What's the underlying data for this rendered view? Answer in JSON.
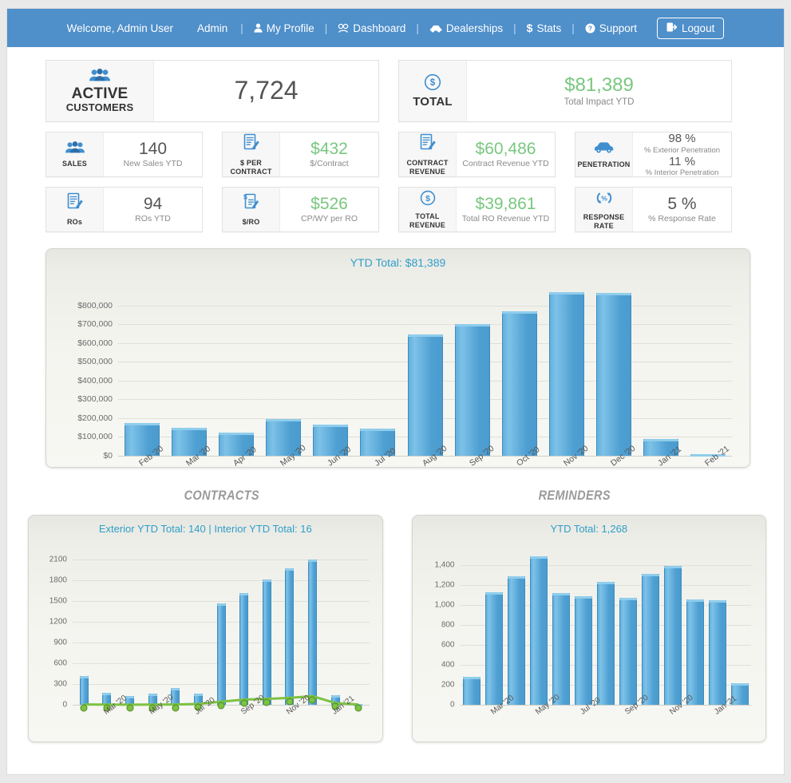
{
  "navbar": {
    "welcome": "Welcome, Admin User",
    "admin": "Admin",
    "separator": "|",
    "items": [
      {
        "label": "My Profile",
        "icon": "user-icon"
      },
      {
        "label": "Dashboard",
        "icon": "dashboard-icon"
      },
      {
        "label": "Dealerships",
        "icon": "car-icon"
      },
      {
        "label": "Stats",
        "icon": "dollar-icon"
      },
      {
        "label": "Support",
        "icon": "question-circle-icon"
      }
    ],
    "logout": "Logout"
  },
  "kpis": {
    "active_customers": {
      "label_line1": "ACTIVE",
      "label_line2": "CUSTOMERS",
      "value": "7,724",
      "icon": "users-icon"
    },
    "total": {
      "label": "TOTAL",
      "value": "$81,389",
      "sub": "Total Impact YTD",
      "icon": "dollar-circle-icon"
    },
    "sales": {
      "label": "SALES",
      "value": "140",
      "sub": "New Sales YTD",
      "icon": "users-icon"
    },
    "per_contract": {
      "label_line1": "$ PER",
      "label_line2": "CONTRACT",
      "value": "$432",
      "sub": "$/Contract",
      "icon": "contract-icon"
    },
    "contract_revenue": {
      "label_line1": "CONTRACT",
      "label_line2": "REVENUE",
      "value": "$60,486",
      "sub": "Contract Revenue YTD",
      "icon": "contract-icon"
    },
    "penetration": {
      "label": "PENETRATION",
      "value1": "98 %",
      "sub1": "% Exterior Penetration",
      "value2": "11 %",
      "sub2": "% Interior Penetration",
      "icon": "car-icon"
    },
    "ros": {
      "label": "ROs",
      "value": "94",
      "sub": "ROs YTD",
      "icon": "contract-icon"
    },
    "per_ro": {
      "label": "$/RO",
      "value": "$526",
      "sub": "CP/WY per RO",
      "icon": "dollar-contract-icon"
    },
    "total_revenue": {
      "label_line1": "TOTAL",
      "label_line2": "REVENUE",
      "value": "$39,861",
      "sub": "Total RO Revenue YTD",
      "icon": "dollar-circle-icon"
    },
    "response_rate": {
      "label_line1": "RESPONSE",
      "label_line2": "RATE",
      "value": "5 %",
      "sub": "% Response Rate",
      "icon": "percent-refresh-icon"
    }
  },
  "sections": {
    "contracts_heading": "CONTRACTS",
    "reminders_heading": "REMINDERS"
  },
  "colors": {
    "navbar": "#4f8fca",
    "bar_blue": "#5ba9d8",
    "line_green": "#7dc242",
    "title_teal": "#2f9fc7",
    "value_green": "#79c77f",
    "icon_blue": "#3f8fd0"
  },
  "chart_data": [
    {
      "id": "impact",
      "type": "bar",
      "title": "YTD Total: $81,389",
      "xlabel": "",
      "ylabel": "",
      "ylim": [
        0,
        900000
      ],
      "ytick_values": [
        0,
        100000,
        200000,
        300000,
        400000,
        500000,
        600000,
        700000,
        800000
      ],
      "ytick_labels": [
        "$0",
        "$100,000",
        "$200,000",
        "$300,000",
        "$400,000",
        "$500,000",
        "$600,000",
        "$700,000",
        "$800,000"
      ],
      "grid": true,
      "legend": "none",
      "categories": [
        "Feb '20",
        "Mar '20",
        "Apr '20",
        "May '20",
        "Jun '20",
        "Jul '20",
        "Aug '20",
        "Sep '20",
        "Oct '20",
        "Nov '20",
        "Dec '20",
        "Jan '21",
        "Feb '21"
      ],
      "values": [
        175000,
        148000,
        123000,
        196000,
        167000,
        143000,
        645000,
        700000,
        768000,
        870000,
        868000,
        90000,
        8000
      ]
    },
    {
      "id": "contracts",
      "type": "bar",
      "title": "Exterior YTD Total: 140 | Interior YTD Total: 16",
      "xlabel": "",
      "ylabel": "",
      "ylim": [
        0,
        2250
      ],
      "ytick_values": [
        0,
        300,
        600,
        900,
        1200,
        1500,
        1800,
        2100
      ],
      "ytick_labels": [
        "0",
        "300",
        "600",
        "900",
        "1200",
        "1500",
        "1800",
        "2100"
      ],
      "grid": true,
      "legend": "none",
      "categories": [
        "Feb '20",
        "Mar '20",
        "Apr '20",
        "May '20",
        "Jun '20",
        "Jul '20",
        "Aug '20",
        "Sep '20",
        "Oct '20",
        "Nov '20",
        "Dec '20",
        "Jan '21",
        "Feb '21"
      ],
      "xtick_labels": [
        "",
        "Mar '20",
        "",
        "May '20",
        "",
        "Jul '20",
        "",
        "Sep '20",
        "",
        "Nov '20",
        "",
        "Jan '21",
        ""
      ],
      "series": [
        {
          "name": "Exterior",
          "kind": "bar",
          "color": "#5ba9d8",
          "values": [
            415,
            175,
            130,
            165,
            240,
            160,
            1470,
            1615,
            1810,
            1975,
            2105,
            140,
            0
          ]
        },
        {
          "name": "Interior",
          "kind": "line",
          "color": "#7dc242",
          "values": [
            5,
            3,
            2,
            3,
            5,
            12,
            45,
            75,
            85,
            100,
            125,
            25,
            5
          ]
        }
      ]
    },
    {
      "id": "reminders",
      "type": "bar",
      "title": "YTD Total: 1,268",
      "xlabel": "",
      "ylabel": "",
      "ylim": [
        0,
        1560
      ],
      "ytick_values": [
        0,
        200,
        400,
        600,
        800,
        1000,
        1200,
        1400
      ],
      "ytick_labels": [
        "0",
        "200",
        "400",
        "600",
        "800",
        "1,000",
        "1,200",
        "1,400"
      ],
      "grid": true,
      "legend": "none",
      "categories": [
        "Feb '20",
        "Mar '20",
        "Apr '20",
        "May '20",
        "Jun '20",
        "Jul '20",
        "Aug '20",
        "Sep '20",
        "Oct '20",
        "Nov '20",
        "Dec '20",
        "Jan '21",
        "Feb '21"
      ],
      "xtick_labels": [
        "",
        "Mar '20",
        "",
        "May '20",
        "",
        "Jul '20",
        "",
        "Sep '20",
        "",
        "Nov '20",
        "",
        "Jan '21",
        ""
      ],
      "values": [
        280,
        1130,
        1290,
        1490,
        1120,
        1085,
        1230,
        1070,
        1310,
        1390,
        1060,
        1045,
        215
      ]
    }
  ]
}
